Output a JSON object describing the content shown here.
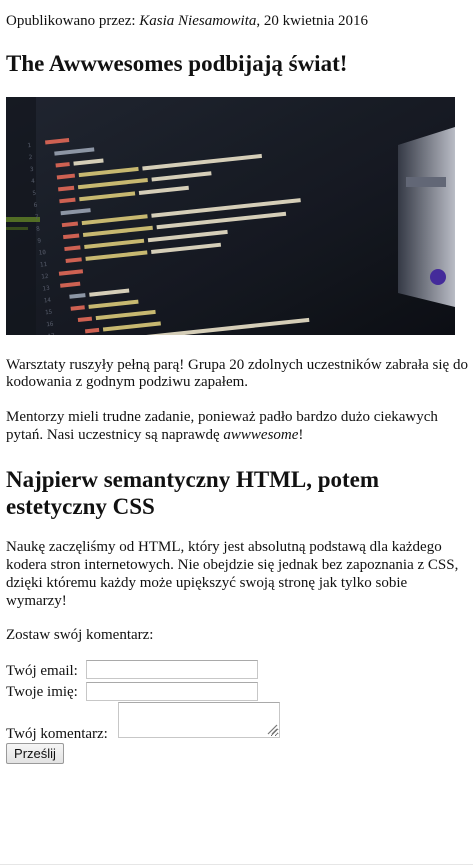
{
  "post": {
    "meta_prefix": "Opublikowano przez: ",
    "author": "Kasia Niesamowita",
    "meta_suffix": ", 20 kwietnia 2016",
    "title": "The Awwwesomes podbijają świat!",
    "image_icon": "code-editor-photo",
    "paragraph1": "Warsztaty ruszyły pełną parą! Grupa 20 zdolnych uczestników zabrała się do kodowania z godnym podziwu zapałem.",
    "paragraph2_before": "Mentorzy mieli trudne zadanie, ponieważ padło bardzo dużo ciekawych pytań. Nasi uczestnicy są naprawdę ",
    "paragraph2_emph": "awwwesome",
    "paragraph2_after": "!",
    "subheading": "Najpierw semantyczny HTML, potem estetyczny CSS",
    "paragraph3": "Naukę zaczęliśmy od HTML, który jest absolutną podstawą dla każdego kodera stron internetowych. Nie obejdzie się jednak bez zapoznania z CSS, dzięki któremu każdy może upiększyć swoją stronę jak tylko sobie wymarzy!"
  },
  "comment_form": {
    "intro": "Zostaw swój komentarz:",
    "email_label": "Twój email:",
    "email_value": "",
    "name_label": "Twoje imię:",
    "name_value": "",
    "comment_label": "Twój komentarz:",
    "comment_value": "",
    "submit_label": "Prześlij"
  }
}
